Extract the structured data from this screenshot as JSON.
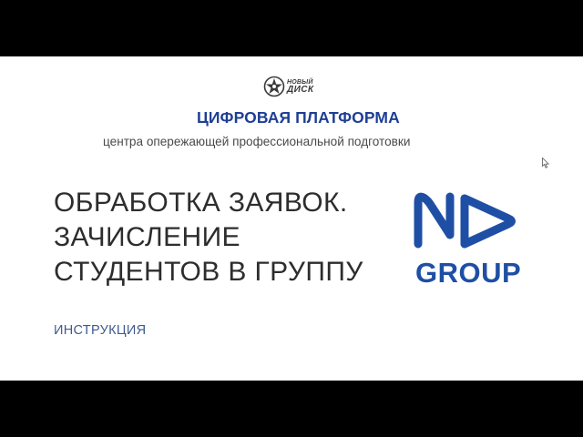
{
  "partner_logo": {
    "line1": "НОВЫЙ",
    "line2": "ДИСК",
    "icon": "globe-star-icon"
  },
  "header": {
    "title": "ЦИФРОВАЯ ПЛАТФОРМА",
    "subtitle": "центра опережающей профессиональной подготовки"
  },
  "main": {
    "title_lines": [
      "ОБРАБОТКА ЗАЯВОК.",
      "ЗАЧИСЛЕНИЕ",
      "СТУДЕНТОВ В ГРУППУ"
    ],
    "doc_type": "ИНСТРУКЦИЯ"
  },
  "brand": {
    "name": "GROUP",
    "icon": "nd-logo-icon"
  },
  "cursor": {
    "icon": "mouse-pointer-icon"
  },
  "colors": {
    "accent_blue": "#1f3f94",
    "brand_blue": "#1f4fa5",
    "title_text": "#2d2d2d",
    "subtitle_text": "#4a4a4a",
    "doc_type_text": "#3f5a8f",
    "slide_background": "#ffffff",
    "letterbox": "#000000"
  }
}
